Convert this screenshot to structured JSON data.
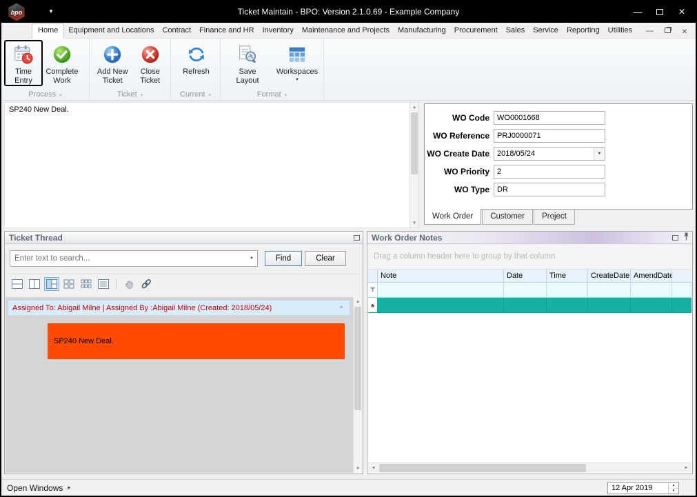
{
  "window": {
    "title": "Ticket Maintain - BPO: Version 2.1.0.69 - Example Company",
    "logo_text": "bpo"
  },
  "icons": {
    "minimize": "—",
    "close": "×",
    "dropdown": "▼",
    "up_arrow": "▲",
    "down_arrow": "▼",
    "left_arrow": "◄",
    "right_arrow": "►",
    "collapse": "^",
    "new_row": "*",
    "group_caret": "▾"
  },
  "menu_tabs": [
    "Home",
    "Equipment and Locations",
    "Contract",
    "Finance and HR",
    "Inventory",
    "Maintenance and Projects",
    "Manufacturing",
    "Procurement",
    "Sales",
    "Service",
    "Reporting",
    "Utilities"
  ],
  "ribbon": {
    "groups": [
      {
        "label": "Process",
        "buttons": [
          {
            "label": "Time Entry"
          },
          {
            "label": "Complete Work"
          }
        ]
      },
      {
        "label": "Ticket",
        "buttons": [
          {
            "label": "Add New Ticket"
          },
          {
            "label": "Close Ticket"
          }
        ]
      },
      {
        "label": "Current",
        "buttons": [
          {
            "label": "Refresh"
          }
        ]
      },
      {
        "label": "Format",
        "buttons": [
          {
            "label": "Save Layout"
          },
          {
            "label": "Workspaces"
          }
        ]
      }
    ]
  },
  "description": {
    "text": "SP240 New Deal."
  },
  "work_order": {
    "fields": [
      {
        "label": "WO Code",
        "value": "WO0001668"
      },
      {
        "label": "WO Reference",
        "value": "PRJ0000071"
      },
      {
        "label": "WO Create Date",
        "value": "2018/05/24"
      },
      {
        "label": "WO Priority",
        "value": "2"
      },
      {
        "label": "WO Type",
        "value": "DR"
      }
    ],
    "tabs": [
      "Work Order",
      "Customer",
      "Project"
    ]
  },
  "ticket_thread": {
    "title": "Ticket Thread",
    "search_placeholder": "Enter text to search...",
    "find_label": "Find",
    "clear_label": "Clear",
    "message_header": "Assigned To: Abigail Milne | Assigned By :Abigail Milne (Created: 2018/05/24)",
    "message_body": "SP240 New Deal."
  },
  "work_order_notes": {
    "title": "Work Order Notes",
    "group_hint": "Drag a column header here to group by that column",
    "columns": [
      "Note",
      "Date",
      "Time",
      "CreateDate",
      "AmendDate"
    ]
  },
  "status_bar": {
    "open_windows": "Open Windows",
    "date": "12 Apr 2019"
  },
  "colors": {
    "teal_row": "#14b1a4",
    "alert_orange": "#ff4b00",
    "message_text": "#c00000"
  }
}
